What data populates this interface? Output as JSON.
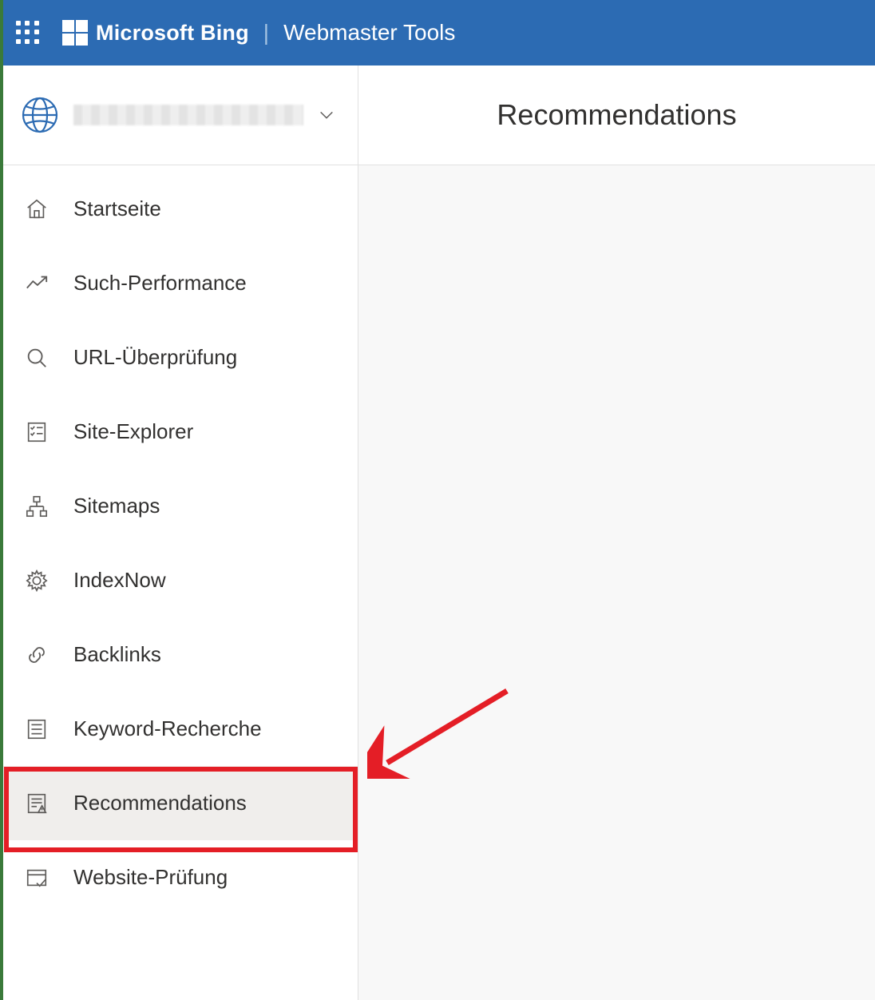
{
  "header": {
    "brand": "Microsoft Bing",
    "product": "Webmaster Tools"
  },
  "sidebar": {
    "items": [
      {
        "id": "home",
        "label": "Startseite",
        "icon": "home-icon"
      },
      {
        "id": "search-performance",
        "label": "Such-Performance",
        "icon": "trend-icon"
      },
      {
        "id": "url-inspection",
        "label": "URL-Überprüfung",
        "icon": "search-icon"
      },
      {
        "id": "site-explorer",
        "label": "Site-Explorer",
        "icon": "checklist-icon"
      },
      {
        "id": "sitemaps",
        "label": "Sitemaps",
        "icon": "sitemap-icon"
      },
      {
        "id": "indexnow",
        "label": "IndexNow",
        "icon": "gear-icon"
      },
      {
        "id": "backlinks",
        "label": "Backlinks",
        "icon": "link-icon"
      },
      {
        "id": "keyword-research",
        "label": "Keyword-Recherche",
        "icon": "list-icon"
      },
      {
        "id": "recommendations",
        "label": "Recommendations",
        "icon": "list-warning-icon",
        "active": true
      },
      {
        "id": "site-scan",
        "label": "Website-Prüfung",
        "icon": "browser-check-icon"
      }
    ]
  },
  "main": {
    "title": "Recommendations"
  }
}
